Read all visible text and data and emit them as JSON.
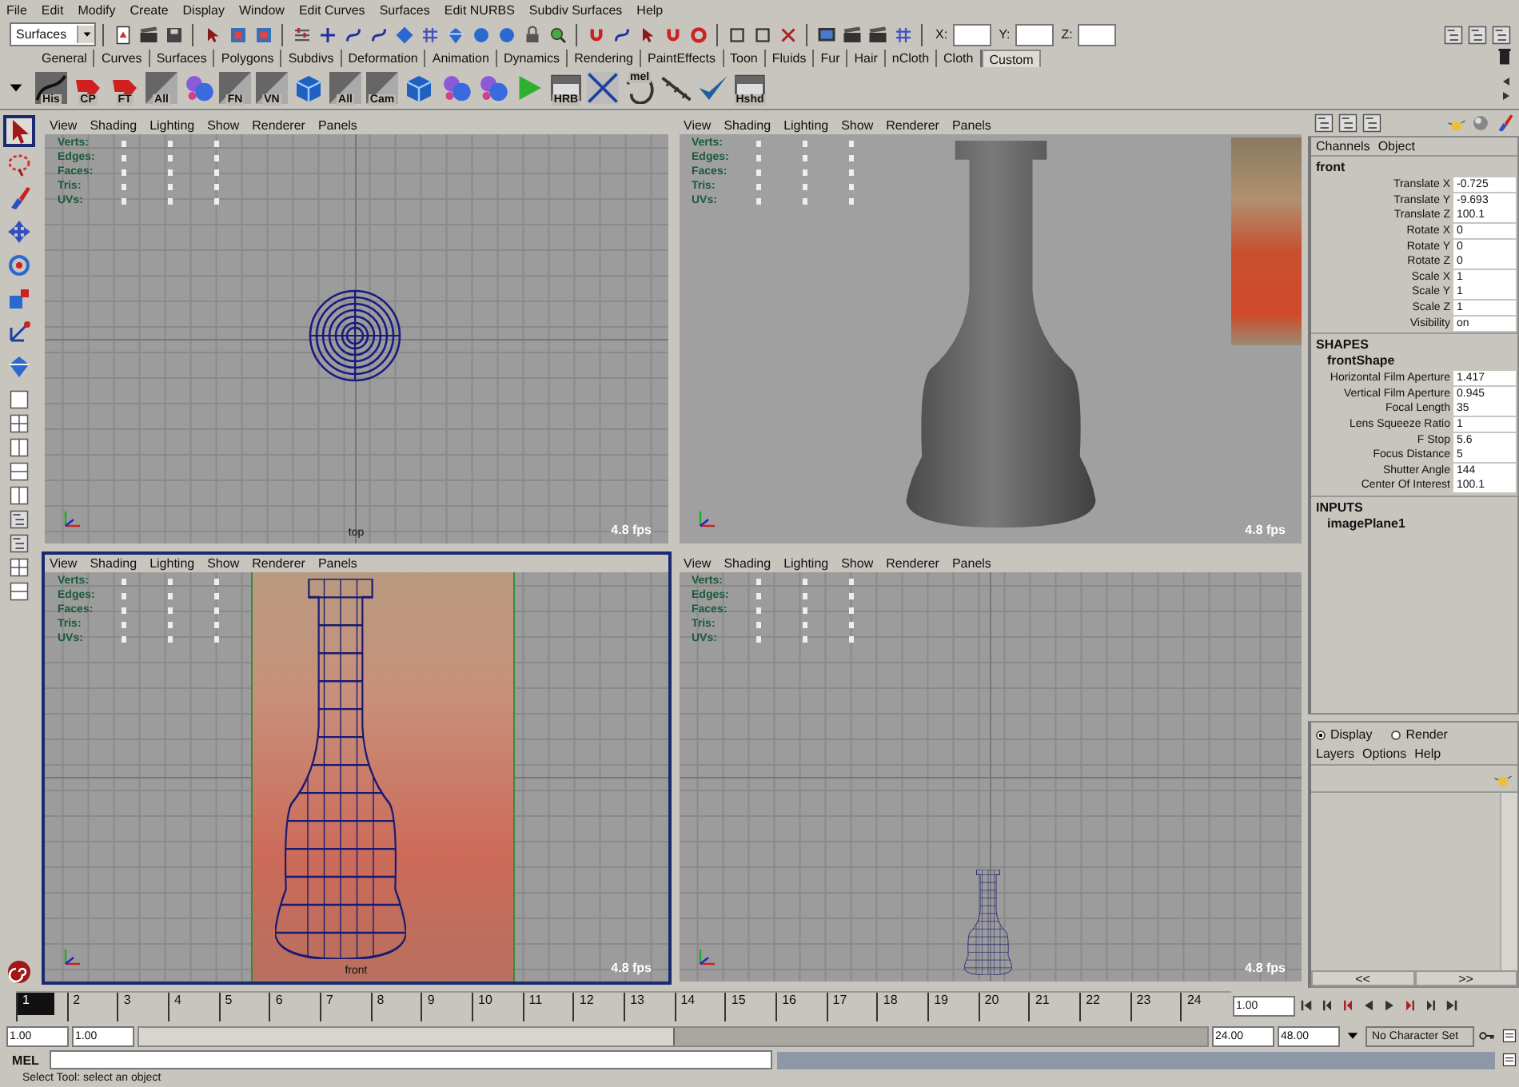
{
  "menu_bar": [
    "File",
    "Edit",
    "Modify",
    "Create",
    "Display",
    "Window",
    "Edit Curves",
    "Surfaces",
    "Edit NURBS",
    "Subdiv Surfaces",
    "Help"
  ],
  "status_line": {
    "menu_set": "Surfaces",
    "fields": [
      {
        "label": "X:"
      },
      {
        "label": "Y:"
      },
      {
        "label": "Z:"
      }
    ]
  },
  "shelf_tabs": [
    {
      "label": "General",
      "selected": false
    },
    {
      "label": "Curves",
      "selected": false
    },
    {
      "label": "Surfaces",
      "selected": false
    },
    {
      "label": "Polygons",
      "selected": false
    },
    {
      "label": "Subdivs",
      "selected": false
    },
    {
      "label": "Deformation",
      "selected": false
    },
    {
      "label": "Animation",
      "selected": false
    },
    {
      "label": "Dynamics",
      "selected": false
    },
    {
      "label": "Rendering",
      "selected": false
    },
    {
      "label": "PaintEffects",
      "selected": false
    },
    {
      "label": "Toon",
      "selected": false
    },
    {
      "label": "Fluids",
      "selected": false
    },
    {
      "label": "Fur",
      "selected": false
    },
    {
      "label": "Hair",
      "selected": false
    },
    {
      "label": "nCloth",
      "selected": false
    },
    {
      "label": "Cloth",
      "selected": false
    },
    {
      "label": "Custom",
      "selected": true
    }
  ],
  "shelf_buttons": [
    {
      "kind": "curve",
      "label": "His"
    },
    {
      "kind": "red",
      "label": "CP"
    },
    {
      "kind": "red",
      "label": "FT"
    },
    {
      "kind": "slant",
      "label": "All"
    },
    {
      "kind": "blobs"
    },
    {
      "kind": "slant",
      "label": "FN"
    },
    {
      "kind": "slant",
      "label": "VN"
    },
    {
      "kind": "cube"
    },
    {
      "kind": "slant",
      "label": "All"
    },
    {
      "kind": "slant",
      "label": "Cam"
    },
    {
      "kind": "cube"
    },
    {
      "kind": "blobs"
    },
    {
      "kind": "blobs"
    },
    {
      "kind": "play"
    },
    {
      "kind": "frame",
      "label": "HRB"
    },
    {
      "kind": "cross"
    },
    {
      "kind": "text",
      "label": "mel"
    },
    {
      "kind": "chain"
    },
    {
      "kind": "check"
    },
    {
      "kind": "frame",
      "label": "Hshd"
    }
  ],
  "toolbox": [
    {
      "kind": "select",
      "selected": true
    },
    {
      "kind": "lasso",
      "selected": false
    },
    {
      "kind": "paint",
      "selected": false
    },
    {
      "kind": "move",
      "selected": false
    },
    {
      "kind": "rotate",
      "selected": false
    },
    {
      "kind": "scale",
      "selected": false
    },
    {
      "kind": "manip",
      "selected": false
    },
    {
      "kind": "last",
      "selected": false
    }
  ],
  "viewports": [
    {
      "kind": "top",
      "active": false,
      "menus": [
        "View",
        "Shading",
        "Lighting",
        "Show",
        "Renderer",
        "Panels"
      ],
      "hud": [
        "Verts:",
        "Edges:",
        "Faces:",
        "Tris:",
        "UVs:"
      ],
      "camera": "top",
      "fps": "4.8 fps"
    },
    {
      "kind": "persp",
      "active": false,
      "menus": [
        "View",
        "Shading",
        "Lighting",
        "Show",
        "Renderer",
        "Panels"
      ],
      "hud": [
        "Verts:",
        "Edges:",
        "Faces:",
        "Tris:",
        "UVs:"
      ],
      "fps": "4.8 fps"
    },
    {
      "kind": "front",
      "active": true,
      "menus": [
        "View",
        "Shading",
        "Lighting",
        "Show",
        "Renderer",
        "Panels"
      ],
      "hud": [
        "Verts:",
        "Edges:",
        "Faces:",
        "Tris:",
        "UVs:"
      ],
      "camera": "front",
      "fps": "4.8 fps"
    },
    {
      "kind": "side",
      "active": false,
      "menus": [
        "View",
        "Shading",
        "Lighting",
        "Show",
        "Renderer",
        "Panels"
      ],
      "hud": [
        "Verts:",
        "Edges:",
        "Faces:",
        "Tris:",
        "UVs:"
      ],
      "fps": "4.8 fps"
    }
  ],
  "channel_box": {
    "menus": [
      "Channels",
      "Object"
    ],
    "node": "front",
    "attributes": [
      {
        "name": "Translate X",
        "value": "-0.725"
      },
      {
        "name": "Translate Y",
        "value": "-9.693"
      },
      {
        "name": "Translate Z",
        "value": "100.1"
      },
      {
        "name": "Rotate X",
        "value": "0"
      },
      {
        "name": "Rotate Y",
        "value": "0"
      },
      {
        "name": "Rotate Z",
        "value": "0"
      },
      {
        "name": "Scale X",
        "value": "1"
      },
      {
        "name": "Scale Y",
        "value": "1"
      },
      {
        "name": "Scale Z",
        "value": "1"
      },
      {
        "name": "Visibility",
        "value": "on"
      }
    ],
    "shapes_header": "SHAPES",
    "shape_node": "frontShape",
    "shape_attributes": [
      {
        "name": "Horizontal Film Aperture",
        "value": "1.417"
      },
      {
        "name": "Vertical Film Aperture",
        "value": "0.945"
      },
      {
        "name": "Focal Length",
        "value": "35"
      },
      {
        "name": "Lens Squeeze Ratio",
        "value": "1"
      },
      {
        "name": "F Stop",
        "value": "5.6"
      },
      {
        "name": "Focus Distance",
        "value": "5"
      },
      {
        "name": "Shutter Angle",
        "value": "144"
      },
      {
        "name": "Center Of Interest",
        "value": "100.1"
      }
    ],
    "inputs_header": "INPUTS",
    "input_node": "imagePlane1"
  },
  "layer_editor": {
    "modes": [
      {
        "label": "Display",
        "selected": true
      },
      {
        "label": "Render",
        "selected": false
      }
    ],
    "menus": [
      "Layers",
      "Options",
      "Help"
    ],
    "nav": [
      "<<",
      ">>"
    ]
  },
  "time_slider": {
    "frames": [
      {
        "label": "1",
        "selected": true
      },
      {
        "label": "2",
        "selected": false
      },
      {
        "label": "3",
        "selected": false
      },
      {
        "label": "4",
        "selected": false
      },
      {
        "label": "5",
        "selected": false
      },
      {
        "label": "6",
        "selected": false
      },
      {
        "label": "7",
        "selected": false
      },
      {
        "label": "8",
        "selected": false
      },
      {
        "label": "9",
        "selected": false
      },
      {
        "label": "10",
        "selected": false
      },
      {
        "label": "11",
        "selected": false
      },
      {
        "label": "12",
        "selected": false
      },
      {
        "label": "13",
        "selected": false
      },
      {
        "label": "14",
        "selected": false
      },
      {
        "label": "15",
        "selected": false
      },
      {
        "label": "16",
        "selected": false
      },
      {
        "label": "17",
        "selected": false
      },
      {
        "label": "18",
        "selected": false
      },
      {
        "label": "19",
        "selected": false
      },
      {
        "label": "20",
        "selected": false
      },
      {
        "label": "21",
        "selected": false
      },
      {
        "label": "22",
        "selected": false
      },
      {
        "label": "23",
        "selected": false
      },
      {
        "label": "24",
        "selected": false
      }
    ],
    "current_time": "1.00"
  },
  "range_slider": {
    "level": 0.5,
    "start_time": "1.00",
    "playback_start": "1.00",
    "playback_end": "24.00",
    "end_time": "48.00",
    "character_set": "No Character Set"
  },
  "command_line": {
    "label": "MEL"
  },
  "help_line": "Select Tool: select an object"
}
